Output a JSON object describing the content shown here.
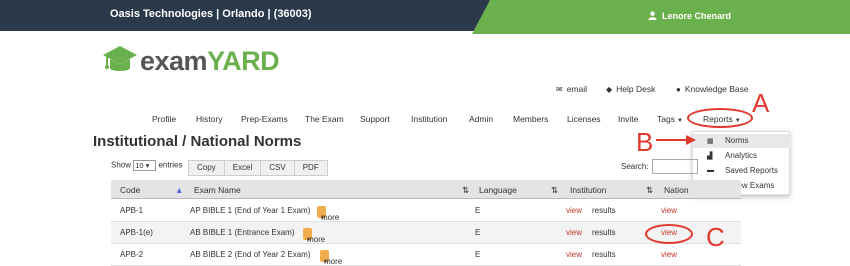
{
  "header": {
    "org": "Oasis Technologies | Orlando | (36003)",
    "user": "Lenore Chenard"
  },
  "logo": {
    "part1": "exam",
    "part2": "YARD"
  },
  "utility": {
    "email": "email",
    "helpdesk": "Help Desk",
    "kb": "Knowledge Base"
  },
  "nav": [
    "Profile",
    "History",
    "Prep-Exams",
    "The Exam",
    "Support",
    "Institution",
    "Admin",
    "Members",
    "Licenses",
    "Invite",
    "Tags",
    "Reports"
  ],
  "dropdown": [
    {
      "label": "Norms",
      "icon": "grid-icon"
    },
    {
      "label": "Analytics",
      "icon": "bar-chart-icon"
    },
    {
      "label": "Saved Reports",
      "icon": "saved-reports-icon"
    },
    {
      "count": "2",
      "label": "New Exams",
      "icon": "flag-icon"
    }
  ],
  "annotations": {
    "a": "A",
    "b": "B",
    "c": "C"
  },
  "page_title": "Institutional / National Norms",
  "controls": {
    "show": "Show",
    "entries_value": "10",
    "entries": "entries",
    "buttons": [
      "Copy",
      "Excel",
      "CSV",
      "PDF"
    ],
    "search": "Search:"
  },
  "table": {
    "headers": [
      "Code",
      "Exam Name",
      "Language",
      "Institution",
      "Nation"
    ],
    "rows": [
      {
        "code": "APB-1",
        "name": "AP BIBLE 1 (End of Year 1 Exam)",
        "more": "more",
        "lang": "E",
        "view": "view",
        "results": "results",
        "nation": "view"
      },
      {
        "code": "APB-1(e)",
        "name": "AB BIBLE 1 (Entrance Exam)",
        "more": "more",
        "lang": "E",
        "view": "view",
        "results": "results",
        "nation": "view"
      },
      {
        "code": "APB-2",
        "name": "AB BIBLE 2 (End of Year 2 Exam)",
        "more": "more",
        "lang": "E",
        "view": "view",
        "results": "results",
        "nation": "view"
      }
    ]
  },
  "colors": {
    "topbar": "#2b3a4a",
    "accent": "#6ab04c",
    "annotation": "#e03a2f",
    "more": "#f0ad4e"
  }
}
